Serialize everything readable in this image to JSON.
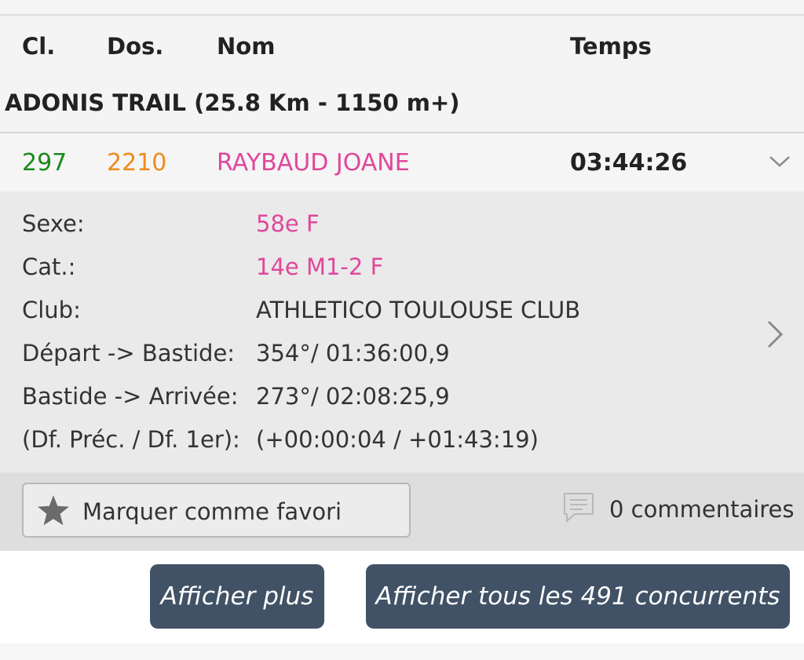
{
  "table_header": {
    "rank": "Cl.",
    "bib": "Dos.",
    "name": "Nom",
    "time": "Temps"
  },
  "race": {
    "title": "ADONIS TRAIL (25.8 Km - 1150 m+)"
  },
  "result": {
    "rank": "297",
    "bib": "2210",
    "name": "RAYBAUD JOANE",
    "time": "03:44:26",
    "colors": {
      "rank": "#1a8a1a",
      "bib": "#f08a1e",
      "name": "#e0479b"
    }
  },
  "details": [
    {
      "label": "Sexe:",
      "value": "58e F"
    },
    {
      "label": "Cat.:",
      "value": "14e M1-2 F"
    },
    {
      "label": "Club:",
      "value": "ATHLETICO TOULOUSE CLUB"
    },
    {
      "label": "Départ -> Bastide:",
      "value": "354°/ 01:36:00,9"
    },
    {
      "label": "Bastide -> Arrivée:",
      "value": "273°/ 02:08:25,9"
    },
    {
      "label": "(Df. Préc. / Df. 1er):",
      "value": "(+00:00:04 / +01:43:19)"
    }
  ],
  "actions": {
    "favorite_label": "Marquer comme favori",
    "favorite_icon": "star-icon",
    "comments_label": "0 commentaires",
    "comments_icon": "comment-icon"
  },
  "buttons": {
    "more": "Afficher plus",
    "all": "Afficher tous les 491 concurrents",
    "color": "#415266"
  }
}
